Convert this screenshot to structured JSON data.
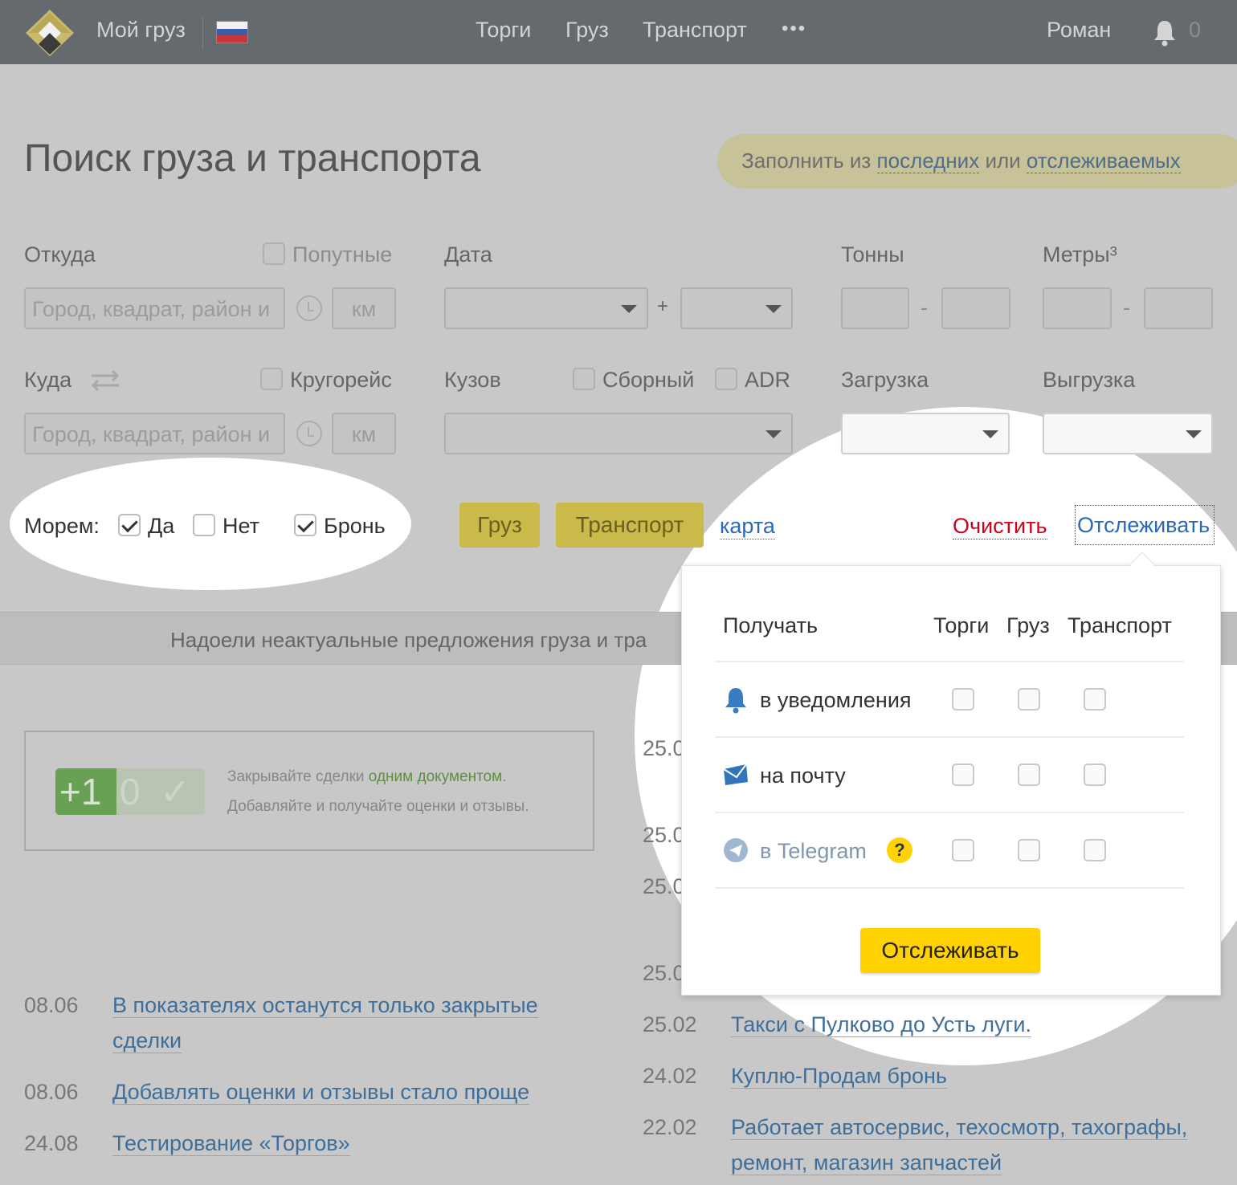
{
  "header": {
    "brand": "Мой груз",
    "nav": [
      "Торги",
      "Груз",
      "Транспорт"
    ],
    "more": "•••",
    "user": "Роман",
    "notifications": "0"
  },
  "page": {
    "title": "Поиск груза и транспорта",
    "fill": {
      "prefix": "Заполнить из",
      "recent": "последних",
      "or": "или",
      "tracked": "отслеживаемых"
    }
  },
  "form": {
    "from_label": "Откуда",
    "along_label": "Попутные",
    "date_label": "Дата",
    "tons_label": "Тонны",
    "meters_label": "Метры³",
    "to_label": "Куда",
    "round_label": "Кругорейс",
    "body_label": "Кузов",
    "combined_label": "Сборный",
    "adr_label": "ADR",
    "loading_label": "Загрузка",
    "unloading_label": "Выгрузка",
    "city_placeholder": "Город, квадрат, район и",
    "km_placeholder": "км",
    "plus": "+",
    "dash": "-",
    "sea_label": "Морем:",
    "sea_yes": "Да",
    "sea_no": "Нет",
    "sea_booking": "Бронь"
  },
  "actions": {
    "cargo": "Груз",
    "transport": "Транспорт",
    "map": "карта",
    "clear": "Очистить",
    "track": "Отслеживать"
  },
  "banner": "Надоели неактуальные предложения груза и тра",
  "promo": {
    "badge": [
      "+1",
      "0",
      "✓"
    ],
    "line1_prefix": "Закрывайте сделки",
    "line1_link": "одним документом",
    "line1_suffix": ".",
    "line2": "Добавляйте и получайте оценки и отзывы."
  },
  "news_left": [
    {
      "date": "08.06",
      "title_line1": "В показателях останутся только закрытые",
      "title_line2": "сделки"
    },
    {
      "date": "08.06",
      "title_line1": "Добавлять оценки и отзывы стало проще"
    },
    {
      "date": "24.08",
      "title_line1": "Тестирование «Торгов»"
    }
  ],
  "news_right_partial": [
    "25.0",
    "25.0",
    "25.0",
    "25.0"
  ],
  "news_right": [
    {
      "date": "25.02",
      "title_line1": "Такси с Пулково до Усть луги."
    },
    {
      "date": "24.02",
      "title_line1": "Куплю-Продам бронь"
    },
    {
      "date": "22.02",
      "title_line1": "Работает автосервис, техосмотр, тахографы,",
      "title_line2": "ремонт, магазин запчастей"
    }
  ],
  "popover": {
    "receive": "Получать",
    "columns": [
      "Торги",
      "Груз",
      "Транспорт"
    ],
    "rows": [
      {
        "label": "в уведомления",
        "icon": "bell-icon"
      },
      {
        "label": "на почту",
        "icon": "mail-icon"
      },
      {
        "label": "в Telegram",
        "icon": "telegram-icon"
      }
    ],
    "help": "?",
    "button": "Отслеживать"
  },
  "colors": {
    "header": "#646a6e",
    "accent_yellow": "#ffd200",
    "link_blue": "#2a69b8",
    "danger_red": "#d0021b"
  }
}
